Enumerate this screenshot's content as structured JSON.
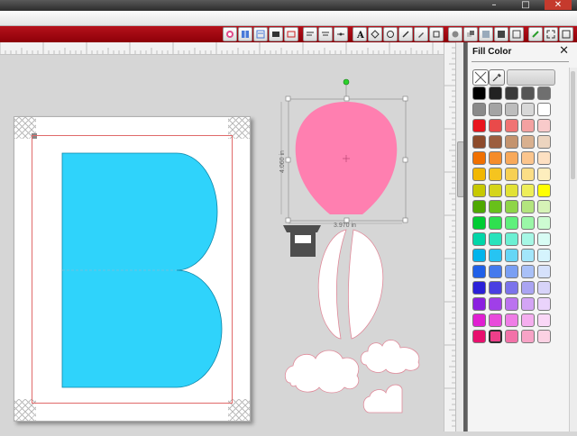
{
  "window": {
    "controls": {
      "minimize": "–",
      "maximize": "□",
      "close": "✕"
    }
  },
  "toolbar": {
    "icons": [
      "color-wheel-icon",
      "view-grid-icon",
      "view-list-icon",
      "mat-icon",
      "layer-icon",
      "align-left-icon",
      "align-center-icon",
      "distribute-icon",
      "text-tool-icon",
      "node-edit-icon",
      "rotate-icon",
      "pen-tool-icon",
      "knife-icon",
      "weld-icon",
      "shadow-icon",
      "group-icon",
      "ungroup-icon",
      "fill-icon",
      "stroke-icon",
      "pencil-icon",
      "fullscreen-icon",
      "expand-icon"
    ]
  },
  "canvas": {
    "balloon": {
      "fill": "#ff7fb0",
      "height_label": "4.060 in",
      "width_label": "3.970 in"
    },
    "letter_b": {
      "fill": "#2fd3fb"
    },
    "basket": {
      "fill": "#4e4e4e"
    }
  },
  "fill_panel": {
    "title": "Fill Color",
    "close_label": "✕",
    "palette": [
      [
        "#000000",
        "#222222",
        "#3a3a3a",
        "#555555",
        "#6f6f6f"
      ],
      [
        "#8a8a8a",
        "#a4a4a4",
        "#bdbdbd",
        "#d8d8d8",
        "#ffffff"
      ],
      [
        "#e8141c",
        "#e94a4a",
        "#f07373",
        "#f4a1a1",
        "#f8caca"
      ],
      [
        "#8d4b2b",
        "#9c5e3f",
        "#c4936e",
        "#d9b08f",
        "#ecd4bf"
      ],
      [
        "#f07000",
        "#f58c2a",
        "#f8a95a",
        "#fbc58d",
        "#fde0c2"
      ],
      [
        "#f2b700",
        "#f5c41f",
        "#f7d053",
        "#fbde86",
        "#fdeebd"
      ],
      [
        "#c7c900",
        "#d5d51a",
        "#e2e235",
        "#eeee5a",
        "#ffff00"
      ],
      [
        "#4ea800",
        "#68c01a",
        "#8fd548",
        "#b3e57e",
        "#d6f3b7"
      ],
      [
        "#00cc33",
        "#2fe04f",
        "#5ff07c",
        "#9af7a7",
        "#cdfbd2"
      ],
      [
        "#00d6a8",
        "#27e3bc",
        "#6cf0d3",
        "#a6f7e5",
        "#d8fcf4"
      ],
      [
        "#00b4ec",
        "#27c4f2",
        "#66d6f6",
        "#a3e6fa",
        "#d5f4fd"
      ],
      [
        "#1f5fe8",
        "#4479ed",
        "#7a9ff3",
        "#a9c0f7",
        "#d6e1fb"
      ],
      [
        "#2a1fd8",
        "#4a3fe2",
        "#7b73eb",
        "#aaa4f2",
        "#d7d3f9"
      ],
      [
        "#8a1fe0",
        "#a03fe8",
        "#bb73ef",
        "#d3a4f5",
        "#ead3fb"
      ],
      [
        "#e01fd2",
        "#e84adb",
        "#ef7de6",
        "#f5aeef",
        "#fad7f7"
      ],
      [
        "#e8106e",
        "#ed3f8a",
        "#f272a8",
        "#f7a3c6",
        "#fbd1e3"
      ]
    ],
    "selected": [
      15,
      1
    ]
  }
}
